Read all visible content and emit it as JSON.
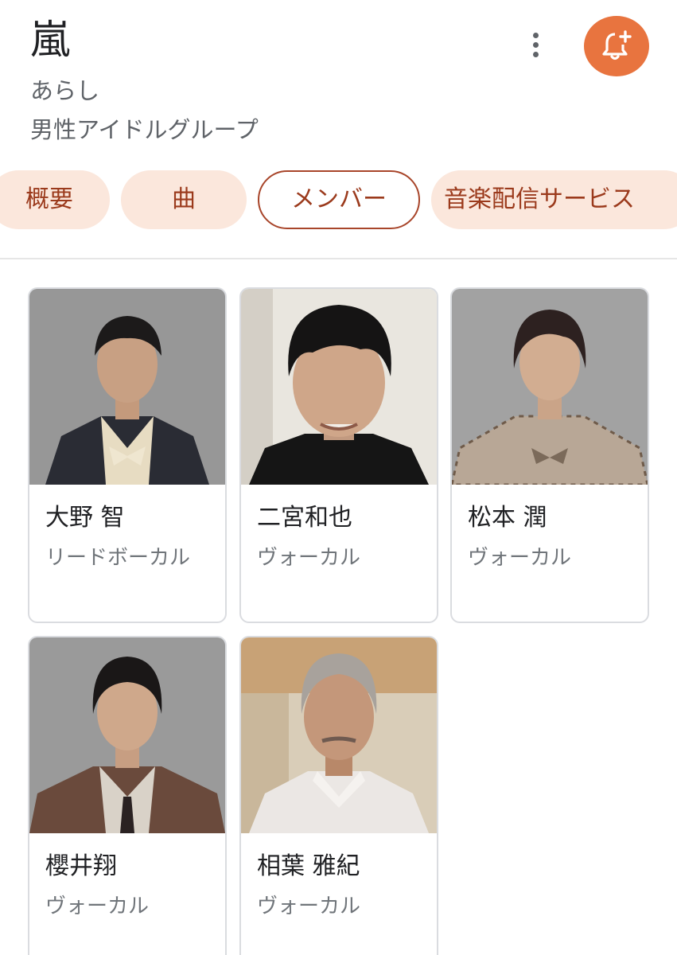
{
  "entity": {
    "title": "嵐",
    "reading": "あらし",
    "category": "男性アイドルグループ"
  },
  "actions": {
    "more_icon": "more-vert-icon",
    "follow_icon": "bell-plus-icon",
    "follow_color": "#e8743f"
  },
  "tabs": [
    {
      "label": "概要",
      "active": false
    },
    {
      "label": "曲",
      "active": false
    },
    {
      "label": "メンバー",
      "active": true
    },
    {
      "label": "音楽配信サービス",
      "active": false
    }
  ],
  "members": [
    {
      "name": "大野 智",
      "role": "リードボーカル"
    },
    {
      "name": "二宮和也",
      "role": "ヴォーカル"
    },
    {
      "name": "松本 潤",
      "role": "ヴォーカル"
    },
    {
      "name": "櫻井翔",
      "role": "ヴォーカル"
    },
    {
      "name": "相葉 雅紀",
      "role": "ヴォーカル"
    }
  ],
  "colors": {
    "chip_bg": "#fbe7dc",
    "chip_text": "#9b3a1c",
    "accent": "#e8743f"
  }
}
